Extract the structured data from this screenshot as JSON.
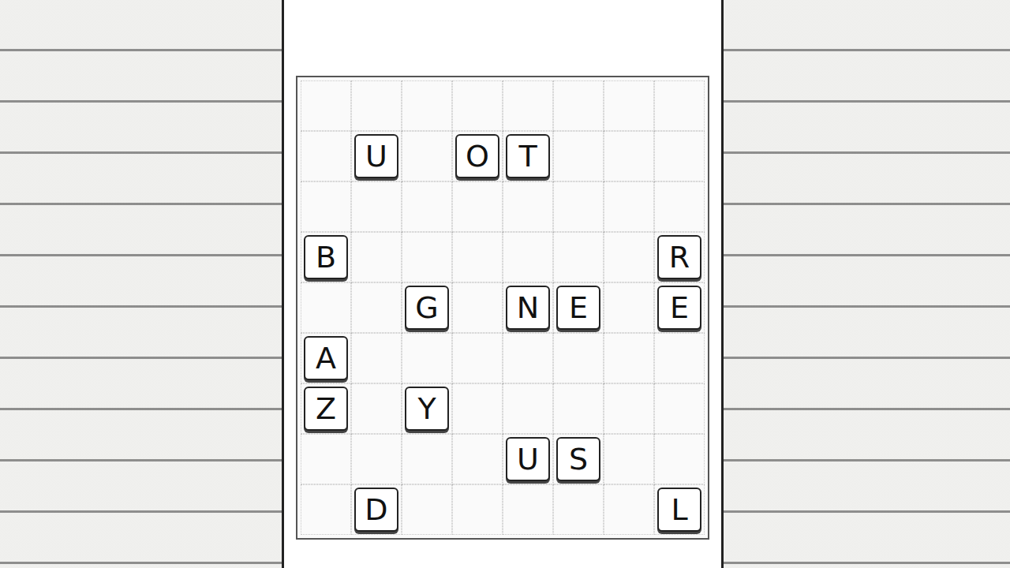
{
  "board": {
    "rows": [
      [
        "",
        "",
        "",
        "",
        "",
        "",
        "",
        ""
      ],
      [
        "",
        "U",
        "",
        "O",
        "T",
        "",
        "",
        ""
      ],
      [
        "",
        "",
        "",
        "",
        "",
        "",
        "",
        ""
      ],
      [
        "B",
        "",
        "",
        "",
        "",
        "",
        "",
        "R"
      ],
      [
        "",
        "",
        "G",
        "",
        "N",
        "E",
        "",
        "E"
      ],
      [
        "A",
        "",
        "",
        "",
        "",
        "",
        "",
        ""
      ],
      [
        "Z",
        "",
        "Y",
        "",
        "",
        "",
        "",
        ""
      ],
      [
        "",
        "",
        "",
        "",
        "U",
        "S",
        "",
        ""
      ],
      [
        "",
        "D",
        "",
        "",
        "",
        "",
        "",
        "L"
      ]
    ]
  }
}
